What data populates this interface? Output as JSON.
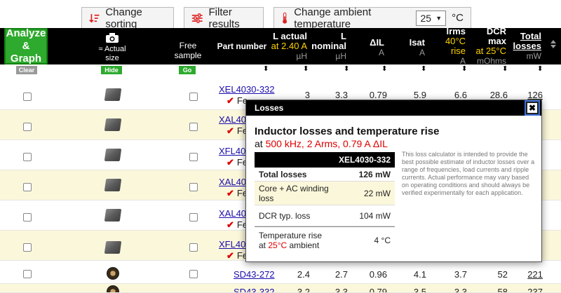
{
  "toolbar": {
    "sort_label": "Change sorting",
    "filter_label": "Filter results",
    "temp_label": "Change ambient temperature",
    "temp_value": "25",
    "temp_unit": "°C"
  },
  "header": {
    "analyze_line1": "Analyze",
    "analyze_line2": "& Graph",
    "actual_size_line1": "≈ Actual",
    "actual_size_line2": "size",
    "free_line1": "Free",
    "free_line2": "sample",
    "part_number": "Part number",
    "l_actual": "L actual",
    "l_actual_cond": "at 2.40 A",
    "l_actual_unit": "µH",
    "l_nominal_1": "L",
    "l_nominal_2": "nominal",
    "l_nominal_unit": "µH",
    "dil": "ΔIL",
    "dil_unit": "A",
    "isat": "Isat",
    "isat_unit": "A",
    "irms": "Irms",
    "irms_cond": "40°C rise",
    "irms_unit": "A",
    "dcr": "DCR max",
    "dcr_cond": "at 25°C",
    "dcr_unit": "mOhms",
    "total_1": "Total",
    "total_2": "losses",
    "total_unit": "mW",
    "clear": "Clear",
    "hide": "Hide",
    "go": "Go"
  },
  "rows": [
    {
      "part": "XEL4030-332",
      "feature": "Fe",
      "l_actual": "3",
      "l_nominal": "3.3",
      "dil": "0.79",
      "isat": "5.9",
      "irms": "6.6",
      "dcr": "28.6",
      "total": "126"
    },
    {
      "part": "XAL403",
      "feature": "Fe"
    },
    {
      "part": "XFL402",
      "feature": "Fe"
    },
    {
      "part": "XAL403",
      "feature": "Fe"
    },
    {
      "part": "XAL403",
      "feature": "Fe"
    },
    {
      "part": "XFL402",
      "feature": "Fe"
    },
    {
      "part": "SD43-272",
      "l_actual": "2.4",
      "l_nominal": "2.7",
      "dil": "0.96",
      "isat": "4.1",
      "irms": "3.7",
      "dcr": "52",
      "total": "221"
    },
    {
      "part": "SD43-332",
      "l_actual": "3.2",
      "l_nominal": "3.3",
      "dil": "0.79",
      "isat": "3.5",
      "irms": "3.3",
      "dcr": "58",
      "total": "237"
    }
  ],
  "modal": {
    "header": "Losses",
    "close": "✖",
    "title": "Inductor losses and temperature rise",
    "sub_prefix": "at ",
    "sub_red": "500 kHz, 2 Arms, 0.79 A ΔIL",
    "note": "This loss calculator is intended to provide the best possible estimate of inductor losses over a range of frequencies, load currents and ripple currents. Actual performance may vary based on operating conditions and should always be verified experimentally for each application.",
    "column": "XEL4030-332",
    "total_label": "Total losses",
    "total_value": "126 mW",
    "core_label": "Core + AC winding loss",
    "core_value": "22 mW",
    "dcr_label": "DCR typ. loss",
    "dcr_value": "104 mW",
    "temp_label_1": "Temperature rise",
    "temp_label_2": "at ",
    "temp_label_red": "25°C",
    "temp_label_3": " ambient",
    "temp_value": "4 °C"
  }
}
